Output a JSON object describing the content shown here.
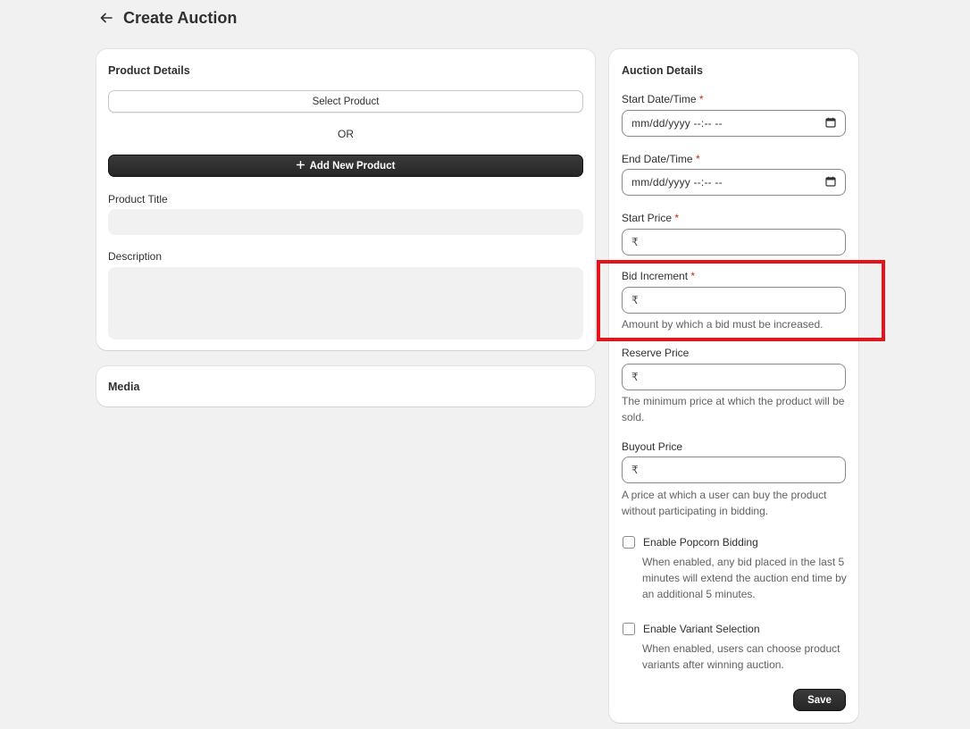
{
  "header": {
    "back_icon": "arrow-left-icon",
    "title": "Create Auction"
  },
  "product_details": {
    "title": "Product Details",
    "select_product_label": "Select Product",
    "or_text": "OR",
    "add_new_product_label": "Add New Product",
    "add_icon": "plus-icon",
    "product_title_label": "Product Title",
    "product_title_value": "",
    "description_label": "Description",
    "description_value": ""
  },
  "media": {
    "title": "Media"
  },
  "auction_details": {
    "title": "Auction Details",
    "required_marker": "*",
    "currency_symbol": "₹",
    "start_datetime": {
      "label": "Start Date/Time",
      "placeholder": "mm/dd/yyyy --:-- --",
      "icon": "calendar-icon"
    },
    "end_datetime": {
      "label": "End Date/Time",
      "placeholder": "mm/dd/yyyy --:-- --",
      "icon": "calendar-icon"
    },
    "start_price": {
      "label": "Start Price",
      "value": ""
    },
    "bid_increment": {
      "label": "Bid Increment",
      "value": "",
      "help": "Amount by which a bid must be increased."
    },
    "reserve_price": {
      "label": "Reserve Price",
      "value": "",
      "help": "The minimum price at which the product will be sold."
    },
    "buyout_price": {
      "label": "Buyout Price",
      "value": "",
      "help": "A price at which a user can buy the product without participating in bidding."
    },
    "popcorn_bidding": {
      "label": "Enable Popcorn Bidding",
      "checked": false,
      "help": "When enabled, any bid placed in the last 5 minutes will extend the auction end time by an additional 5 minutes."
    },
    "variant_selection": {
      "label": "Enable Variant Selection",
      "checked": false,
      "help": "When enabled, users can choose product variants after winning auction."
    },
    "save_label": "Save"
  },
  "colors": {
    "background": "#f1f1f1",
    "primary_button": "#303030",
    "required": "#c5280c",
    "highlight": "#e3141b"
  }
}
